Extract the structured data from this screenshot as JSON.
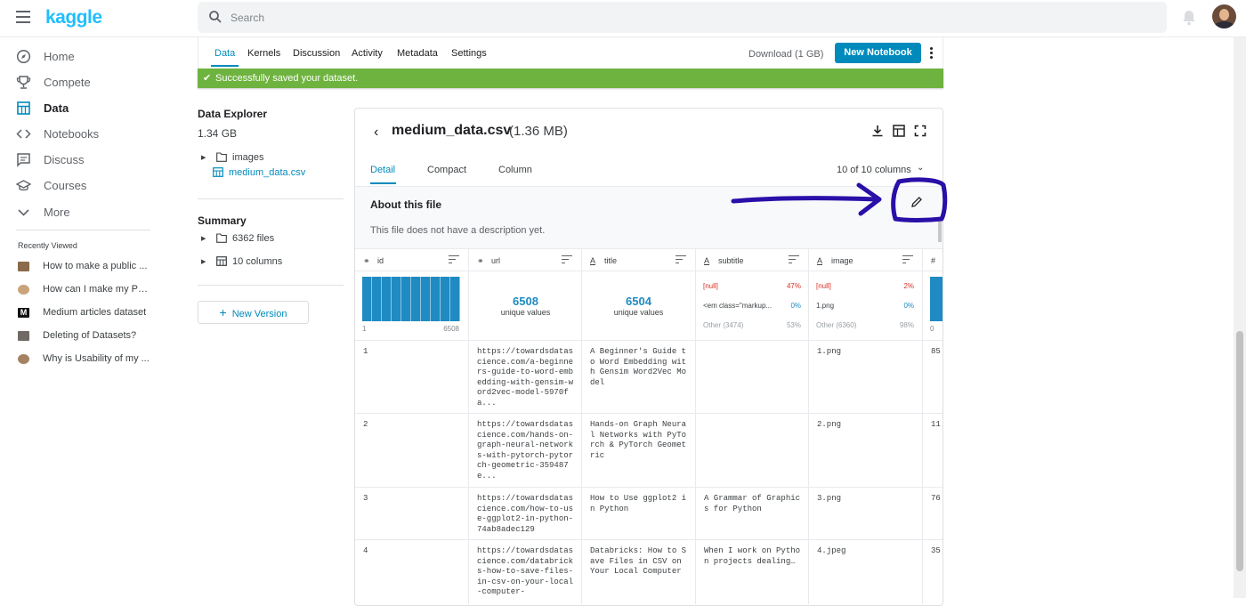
{
  "header": {
    "logo": "kaggle",
    "search_placeholder": "Search"
  },
  "sidebar": {
    "items": [
      {
        "label": "Home",
        "icon": "compass-icon"
      },
      {
        "label": "Compete",
        "icon": "trophy-icon"
      },
      {
        "label": "Data",
        "icon": "table-icon",
        "active": true
      },
      {
        "label": "Notebooks",
        "icon": "code-icon"
      },
      {
        "label": "Discuss",
        "icon": "chat-icon"
      },
      {
        "label": "Courses",
        "icon": "graduation-cap-icon"
      },
      {
        "label": "More",
        "icon": "chevron-down-icon"
      }
    ],
    "recently_viewed_label": "Recently Viewed",
    "recent": [
      "How to make a public ...",
      "How can I make my Pu...",
      "Medium articles dataset",
      "Deleting of Datasets?",
      "Why is Usability of my ..."
    ]
  },
  "dataset_tabs": [
    "Data",
    "Kernels",
    "Discussion",
    "Activity",
    "Metadata",
    "Settings"
  ],
  "download_label": "Download (1 GB)",
  "new_notebook_label": "New Notebook",
  "success_message": "Successfully saved your dataset.",
  "explorer": {
    "title": "Data Explorer",
    "size": "1.34 GB",
    "tree": [
      {
        "name": "images",
        "type": "folder"
      },
      {
        "name": "medium_data.csv",
        "type": "file"
      }
    ],
    "summary_title": "Summary",
    "summary": [
      "6362 files",
      "10 columns"
    ],
    "new_version_label": "New Version"
  },
  "file_panel": {
    "filename": "medium_data.csv",
    "size": "(1.36 MB)",
    "tabs": [
      "Detail",
      "Compact",
      "Column"
    ],
    "column_count": "10 of 10 columns",
    "about_title": "About this file",
    "about_desc": "This file does not have a description yet."
  },
  "table": {
    "columns": [
      {
        "name": "id",
        "type_icon": "link-icon"
      },
      {
        "name": "url",
        "type_icon": "link-icon"
      },
      {
        "name": "title",
        "type_icon": "text-icon"
      },
      {
        "name": "subtitle",
        "type_icon": "text-icon"
      },
      {
        "name": "image",
        "type_icon": "text-icon"
      },
      {
        "name": "#",
        "type_icon": "hash-icon"
      }
    ],
    "id_stats": {
      "min": "1",
      "max": "6508"
    },
    "url_stats": {
      "unique": "6508",
      "unique_label": "unique values"
    },
    "title_stats": {
      "unique": "6504",
      "unique_label": "unique values"
    },
    "subtitle_stats": [
      {
        "label": "[null]",
        "pct": "47%",
        "kind": "null"
      },
      {
        "label": "<em class=\"markup...",
        "pct": "0%",
        "kind": "value"
      },
      {
        "label": "Other (3474)",
        "pct": "53%",
        "kind": "other"
      }
    ],
    "image_stats": [
      {
        "label": "[null]",
        "pct": "2%",
        "kind": "null"
      },
      {
        "label": "1.png",
        "pct": "0%",
        "kind": "value"
      },
      {
        "label": "Other (6360)",
        "pct": "98%",
        "kind": "other"
      }
    ],
    "last_col_stat": "0",
    "rows": [
      {
        "id": "1",
        "url": "https://towardsdatascience.com/a-beginners-guide-to-word-embedding-with-gensim-word2vec-model-5970fa...",
        "title": "A Beginner's Guide to Word Embedding with Gensim Word2Vec Model",
        "subtitle": "",
        "image": "1.png",
        "last": "85"
      },
      {
        "id": "2",
        "url": "https://towardsdatascience.com/hands-on-graph-neural-networks-with-pytorch-pytorch-geometric-359487e...",
        "title": "Hands-on Graph Neural Networks with PyTorch & PyTorch Geometric",
        "subtitle": "",
        "image": "2.png",
        "last": "11"
      },
      {
        "id": "3",
        "url": "https://towardsdatascience.com/how-to-use-ggplot2-in-python-74ab8adec129",
        "title": "How to Use ggplot2 in Python",
        "subtitle": "A Grammar of Graphics for Python",
        "image": "3.png",
        "last": "76"
      },
      {
        "id": "4",
        "url": "https://towardsdatascience.com/databricks-how-to-save-files-in-csv-on-your-local-computer-",
        "title": "Databricks: How to Save Files in CSV on Your Local Computer",
        "subtitle": "When I work on Python projects dealing…",
        "image": "4.jpeg",
        "last": "35"
      }
    ]
  },
  "colors": {
    "accent": "#008abc",
    "success": "#6eb33f",
    "annotation": "#2a0fa8",
    "histogram": "#1f8bc2",
    "null_red": "#d93025"
  }
}
